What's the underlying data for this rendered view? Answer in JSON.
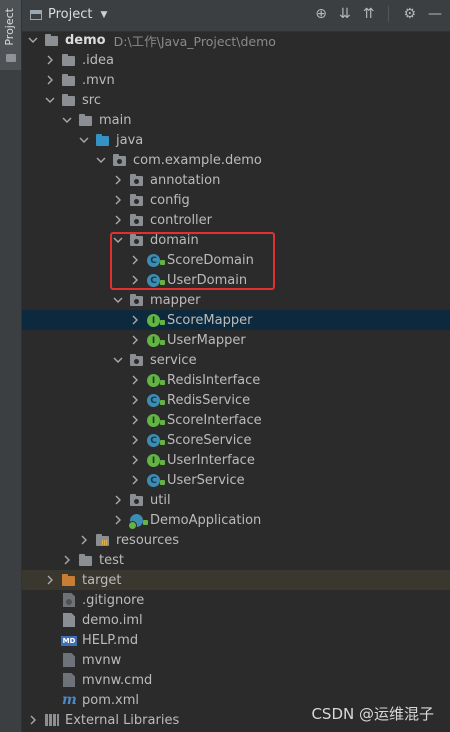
{
  "side": {
    "tab_label": "Project"
  },
  "toolbar": {
    "title": "Project"
  },
  "tree": [
    {
      "label": "demo",
      "extra": "D:\\工作\\Java_Project\\demo",
      "depth": 0,
      "arrow": "down",
      "icon": "folder",
      "bold": true
    },
    {
      "label": ".idea",
      "depth": 1,
      "arrow": "right",
      "icon": "folder"
    },
    {
      "label": ".mvn",
      "depth": 1,
      "arrow": "right",
      "icon": "folder"
    },
    {
      "label": "src",
      "depth": 1,
      "arrow": "down",
      "icon": "folder"
    },
    {
      "label": "main",
      "depth": 2,
      "arrow": "down",
      "icon": "folder"
    },
    {
      "label": "java",
      "depth": 3,
      "arrow": "down",
      "icon": "folder-blue"
    },
    {
      "label": "com.example.demo",
      "depth": 4,
      "arrow": "down",
      "icon": "package"
    },
    {
      "label": "annotation",
      "depth": 5,
      "arrow": "right",
      "icon": "package"
    },
    {
      "label": "config",
      "depth": 5,
      "arrow": "right",
      "icon": "package"
    },
    {
      "label": "controller",
      "depth": 5,
      "arrow": "right",
      "icon": "package"
    },
    {
      "label": "domain",
      "depth": 5,
      "arrow": "down",
      "icon": "package"
    },
    {
      "label": "ScoreDomain",
      "depth": 6,
      "arrow": "right",
      "icon": "class"
    },
    {
      "label": "UserDomain",
      "depth": 6,
      "arrow": "right",
      "icon": "class"
    },
    {
      "label": "mapper",
      "depth": 5,
      "arrow": "down",
      "icon": "package"
    },
    {
      "label": "ScoreMapper",
      "depth": 6,
      "arrow": "right",
      "icon": "interface",
      "selected": true
    },
    {
      "label": "UserMapper",
      "depth": 6,
      "arrow": "right",
      "icon": "interface"
    },
    {
      "label": "service",
      "depth": 5,
      "arrow": "down",
      "icon": "package"
    },
    {
      "label": "RedisInterface",
      "depth": 6,
      "arrow": "right",
      "icon": "interface"
    },
    {
      "label": "RedisService",
      "depth": 6,
      "arrow": "right",
      "icon": "class"
    },
    {
      "label": "ScoreInterface",
      "depth": 6,
      "arrow": "right",
      "icon": "interface"
    },
    {
      "label": "ScoreService",
      "depth": 6,
      "arrow": "right",
      "icon": "class"
    },
    {
      "label": "UserInterface",
      "depth": 6,
      "arrow": "right",
      "icon": "interface"
    },
    {
      "label": "UserService",
      "depth": 6,
      "arrow": "right",
      "icon": "class"
    },
    {
      "label": "util",
      "depth": 5,
      "arrow": "right",
      "icon": "package"
    },
    {
      "label": "DemoApplication",
      "depth": 5,
      "arrow": "right",
      "icon": "app"
    },
    {
      "label": "resources",
      "depth": 3,
      "arrow": "right",
      "icon": "resources"
    },
    {
      "label": "test",
      "depth": 2,
      "arrow": "right",
      "icon": "folder"
    },
    {
      "label": "target",
      "depth": 1,
      "arrow": "right",
      "icon": "folder-orange",
      "target": true
    },
    {
      "label": ".gitignore",
      "depth": 1,
      "arrow": "none",
      "icon": "gitignore"
    },
    {
      "label": "demo.iml",
      "depth": 1,
      "arrow": "none",
      "icon": "file"
    },
    {
      "label": "HELP.md",
      "depth": 1,
      "arrow": "none",
      "icon": "md"
    },
    {
      "label": "mvnw",
      "depth": 1,
      "arrow": "none",
      "icon": "file-cmd"
    },
    {
      "label": "mvnw.cmd",
      "depth": 1,
      "arrow": "none",
      "icon": "file-cmd"
    },
    {
      "label": "pom.xml",
      "depth": 1,
      "arrow": "none",
      "icon": "maven"
    },
    {
      "label": "External Libraries",
      "depth": 0,
      "arrow": "right",
      "icon": "libraries"
    }
  ],
  "icons": {
    "md_badge": "MD",
    "maven_glyph": "m",
    "class_glyph": "C",
    "interface_glyph": "I"
  },
  "watermark": "CSDN @运维混子"
}
